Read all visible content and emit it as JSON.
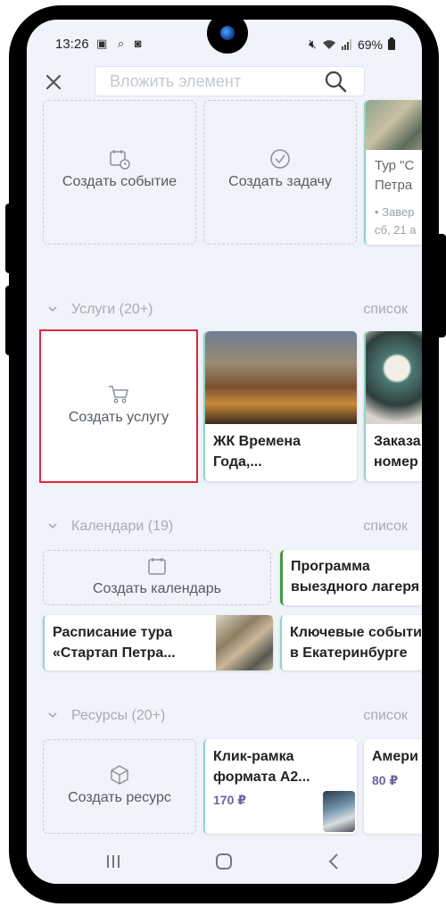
{
  "status": {
    "time": "13:26",
    "battery": "69%"
  },
  "search": {
    "placeholder": "Вложить элемент"
  },
  "events_section": {
    "create_event": "Создать событие",
    "create_task": "Создать задачу",
    "tour_card": {
      "title": "Тур \"С",
      "title2": "Петра",
      "status": "• Завер",
      "date": "сб, 21 а"
    }
  },
  "services_section": {
    "title": "Услуги (20+)",
    "list": "список",
    "create": "Создать услугу",
    "cards": [
      {
        "title": "ЖК Времена Года,..."
      },
      {
        "title": "Заказа номер"
      }
    ],
    "card1_line1": "ЖК Времена",
    "card1_line2": "Года,...",
    "card2_line1": "Заказа",
    "card2_line2": "номер"
  },
  "calendars_section": {
    "title": "Календари (19)",
    "list": "список",
    "create": "Создать календарь",
    "program_line1": "Программа",
    "program_line2": "выездного лагеря",
    "tour_line1": "Расписание тура",
    "tour_line2": "«Стартап Петра...",
    "events_line1": "Ключевые событи",
    "events_line2": "в Екатеринбурге"
  },
  "resources_section": {
    "title": "Ресурсы (20+)",
    "list": "список",
    "create": "Создать ресурс",
    "frame_line1": "Клик-рамка",
    "frame_line2": "формата А2...",
    "frame_price": "170 ₽",
    "second_title": "Амери",
    "second_price": "80 ₽"
  },
  "colors": {
    "selected": "#e0283b",
    "accent_green": "#3f9b3f",
    "price": "#6b62a0"
  }
}
